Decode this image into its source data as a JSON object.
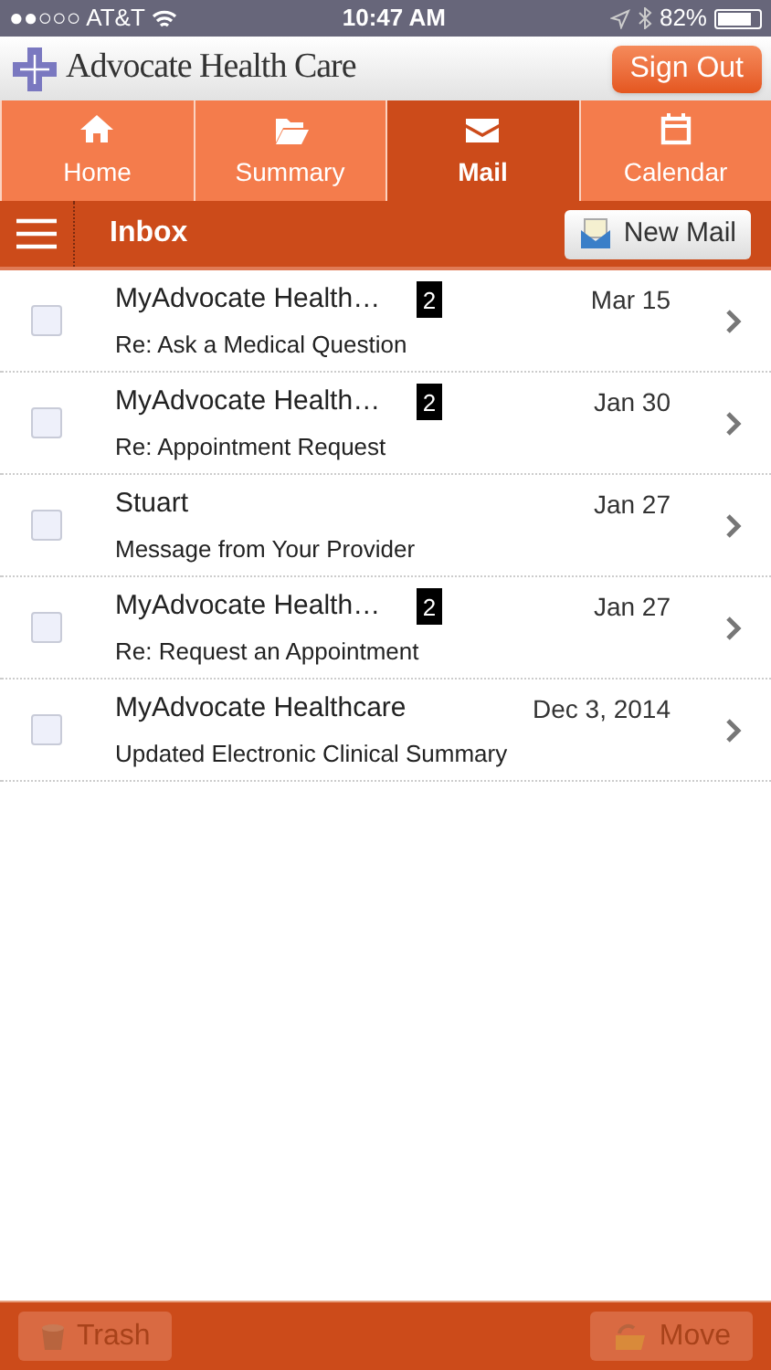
{
  "status_bar": {
    "carrier": "●●○○○ AT&T",
    "time": "10:47 AM",
    "battery": "82%"
  },
  "header": {
    "brand": "Advocate Health Care",
    "sign_out": "Sign Out"
  },
  "tabs": [
    {
      "label": "Home",
      "kind": "home",
      "selected": false
    },
    {
      "label": "Summary",
      "kind": "folder",
      "selected": false
    },
    {
      "label": "Mail",
      "kind": "mail",
      "selected": true
    },
    {
      "label": "Calendar",
      "kind": "calendar",
      "selected": false
    }
  ],
  "toolbar": {
    "title": "Inbox",
    "new_mail": "New Mail"
  },
  "messages": [
    {
      "sender": "MyAdvocate Health…",
      "count": "2",
      "date": "Mar 15",
      "subject": "Re: Ask a Medical Question",
      "checked": false
    },
    {
      "sender": "MyAdvocate Health…",
      "count": "2",
      "date": "Jan 30",
      "subject": "Re: Appointment Request",
      "checked": false
    },
    {
      "sender": "Stuart",
      "date": "Jan 27",
      "subject": "Message from Your Provider",
      "checked": false
    },
    {
      "sender": "MyAdvocate Health…",
      "count": "2",
      "date": "Jan 27",
      "subject": "Re: Request an Appointment",
      "checked": false
    },
    {
      "sender": "MyAdvocate Healthcare",
      "date": "Dec 3, 2014",
      "subject": "Updated Electronic Clinical Summary",
      "checked": false
    }
  ],
  "footer": {
    "buttons": [
      {
        "label": "Trash",
        "kind": "trash",
        "disabled": true
      },
      {
        "label": "Move",
        "kind": "move",
        "disabled": true
      }
    ]
  }
}
